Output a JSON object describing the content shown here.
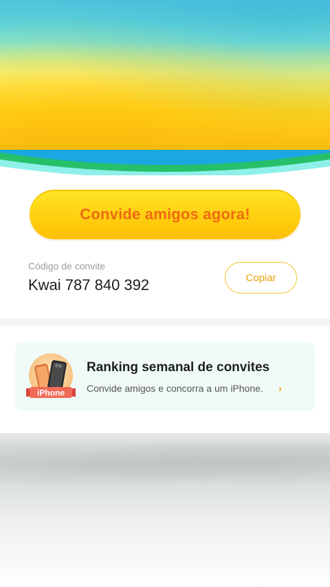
{
  "invite": {
    "cta_label": "Convide amigos agora!",
    "code_label": "Código de convite",
    "code_value": "Kwai 787 840 392",
    "copy_label": "Copiar"
  },
  "ranking": {
    "badge_text": "iPhone",
    "title": "Ranking semanal de convites",
    "subtitle": "Convide amigos e concorra a um iPhone.",
    "chevron_icon": "chevron-right-icon"
  },
  "colors": {
    "accent_yellow": "#ffd00f",
    "cta_text": "#ee6a12",
    "copy_text": "#e9a10e",
    "ranking_bg": "#f0fbf8"
  }
}
